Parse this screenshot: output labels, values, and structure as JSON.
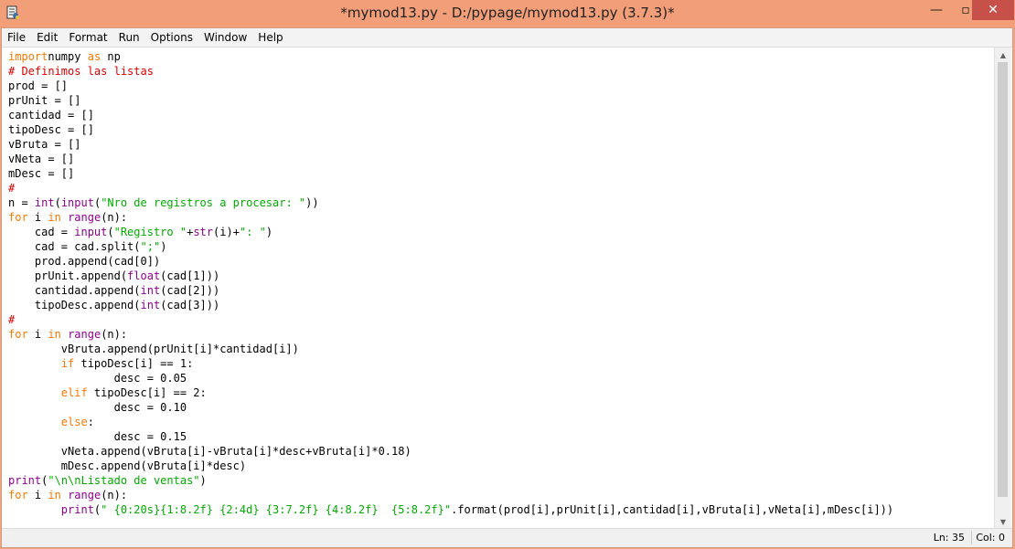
{
  "window": {
    "title": "*mymod13.py - D:/pypage/mymod13.py (3.7.3)*",
    "controls": {
      "minimize": "—",
      "maximize": "▫",
      "close": "✕"
    }
  },
  "menu": [
    "File",
    "Edit",
    "Format",
    "Run",
    "Options",
    "Window",
    "Help"
  ],
  "code_lines": [
    [
      [
        "kw",
        "import"
      ],
      [
        "",
        "numpy "
      ],
      [
        "kw",
        "as"
      ],
      [
        "",
        " np"
      ]
    ],
    [
      [
        "cm",
        "# Definimos las listas"
      ]
    ],
    [
      [
        "",
        "prod = []"
      ]
    ],
    [
      [
        "",
        "prUnit = []"
      ]
    ],
    [
      [
        "",
        "cantidad = []"
      ]
    ],
    [
      [
        "",
        "tipoDesc = []"
      ]
    ],
    [
      [
        "",
        "vBruta = []"
      ]
    ],
    [
      [
        "",
        "vNeta = []"
      ]
    ],
    [
      [
        "",
        "mDesc = []"
      ]
    ],
    [
      [
        "cm",
        "#"
      ]
    ],
    [
      [
        "",
        "n = "
      ],
      [
        "bi",
        "int"
      ],
      [
        "",
        "("
      ],
      [
        "bi",
        "input"
      ],
      [
        "",
        "("
      ],
      [
        "st",
        "\"Nro de registros a procesar: \""
      ],
      [
        "",
        "))"
      ]
    ],
    [
      [
        "kw",
        "for"
      ],
      [
        "",
        " i "
      ],
      [
        "kw",
        "in"
      ],
      [
        "",
        " "
      ],
      [
        "bi",
        "range"
      ],
      [
        "",
        "(n):"
      ]
    ],
    [
      [
        "",
        "    cad = "
      ],
      [
        "bi",
        "input"
      ],
      [
        "",
        "("
      ],
      [
        "st",
        "\"Registro \""
      ],
      [
        "",
        "+"
      ],
      [
        "bi",
        "str"
      ],
      [
        "",
        "(i)+"
      ],
      [
        "st",
        "\": \""
      ],
      [
        "",
        ")"
      ]
    ],
    [
      [
        "",
        "    cad = cad.split("
      ],
      [
        "st",
        "\";\""
      ],
      [
        "",
        ")"
      ]
    ],
    [
      [
        "",
        "    prod.append(cad[0])"
      ]
    ],
    [
      [
        "",
        "    prUnit.append("
      ],
      [
        "bi",
        "float"
      ],
      [
        "",
        "(cad[1]))"
      ]
    ],
    [
      [
        "",
        "    cantidad.append("
      ],
      [
        "bi",
        "int"
      ],
      [
        "",
        "(cad[2]))"
      ]
    ],
    [
      [
        "",
        "    tipoDesc.append("
      ],
      [
        "bi",
        "int"
      ],
      [
        "",
        "(cad[3]))"
      ]
    ],
    [
      [
        "cm",
        "#"
      ]
    ],
    [
      [
        "kw",
        "for"
      ],
      [
        "",
        " i "
      ],
      [
        "kw",
        "in"
      ],
      [
        "",
        " "
      ],
      [
        "bi",
        "range"
      ],
      [
        "",
        "(n):"
      ]
    ],
    [
      [
        "",
        "        vBruta.append(prUnit[i]*cantidad[i])"
      ]
    ],
    [
      [
        "",
        "        "
      ],
      [
        "kw",
        "if"
      ],
      [
        "",
        " tipoDesc[i] == 1:"
      ]
    ],
    [
      [
        "",
        "                desc = 0.05"
      ]
    ],
    [
      [
        "",
        "        "
      ],
      [
        "kw",
        "elif"
      ],
      [
        "",
        " tipoDesc[i] == 2:"
      ]
    ],
    [
      [
        "",
        "                desc = 0.10"
      ]
    ],
    [
      [
        "",
        "        "
      ],
      [
        "kw",
        "else"
      ],
      [
        "",
        ":"
      ]
    ],
    [
      [
        "",
        "                desc = 0.15"
      ]
    ],
    [
      [
        "",
        "        vNeta.append(vBruta[i]-vBruta[i]*desc+vBruta[i]*0.18)"
      ]
    ],
    [
      [
        "",
        "        mDesc.append(vBruta[i]*desc)"
      ]
    ],
    [
      [
        "bi",
        "print"
      ],
      [
        "",
        "("
      ],
      [
        "st",
        "\"\\n\\nListado de ventas\""
      ],
      [
        "",
        ")"
      ]
    ],
    [
      [
        "kw",
        "for"
      ],
      [
        "",
        " i "
      ],
      [
        "kw",
        "in"
      ],
      [
        "",
        " "
      ],
      [
        "bi",
        "range"
      ],
      [
        "",
        "(n):"
      ]
    ],
    [
      [
        "",
        "        "
      ],
      [
        "bi",
        "print"
      ],
      [
        "",
        "("
      ],
      [
        "st",
        "\" {0:20s}{1:8.2f} {2:4d} {3:7.2f} {4:8.2f}  {5:8.2f}\""
      ],
      [
        "",
        ".format(prod[i],prUnit[i],cantidad[i],vBruta[i],vNeta[i],mDesc[i]))"
      ]
    ]
  ],
  "status": {
    "line": "Ln: 35",
    "col": "Col: 0"
  },
  "colors": {
    "keyword": "#ff7700",
    "builtin": "#900090",
    "string": "#00aa00",
    "comment": "#dd0000",
    "titlebar": "#f29e78",
    "close_button": "#c7514a"
  },
  "icons": {
    "app": "python-idle-icon"
  }
}
